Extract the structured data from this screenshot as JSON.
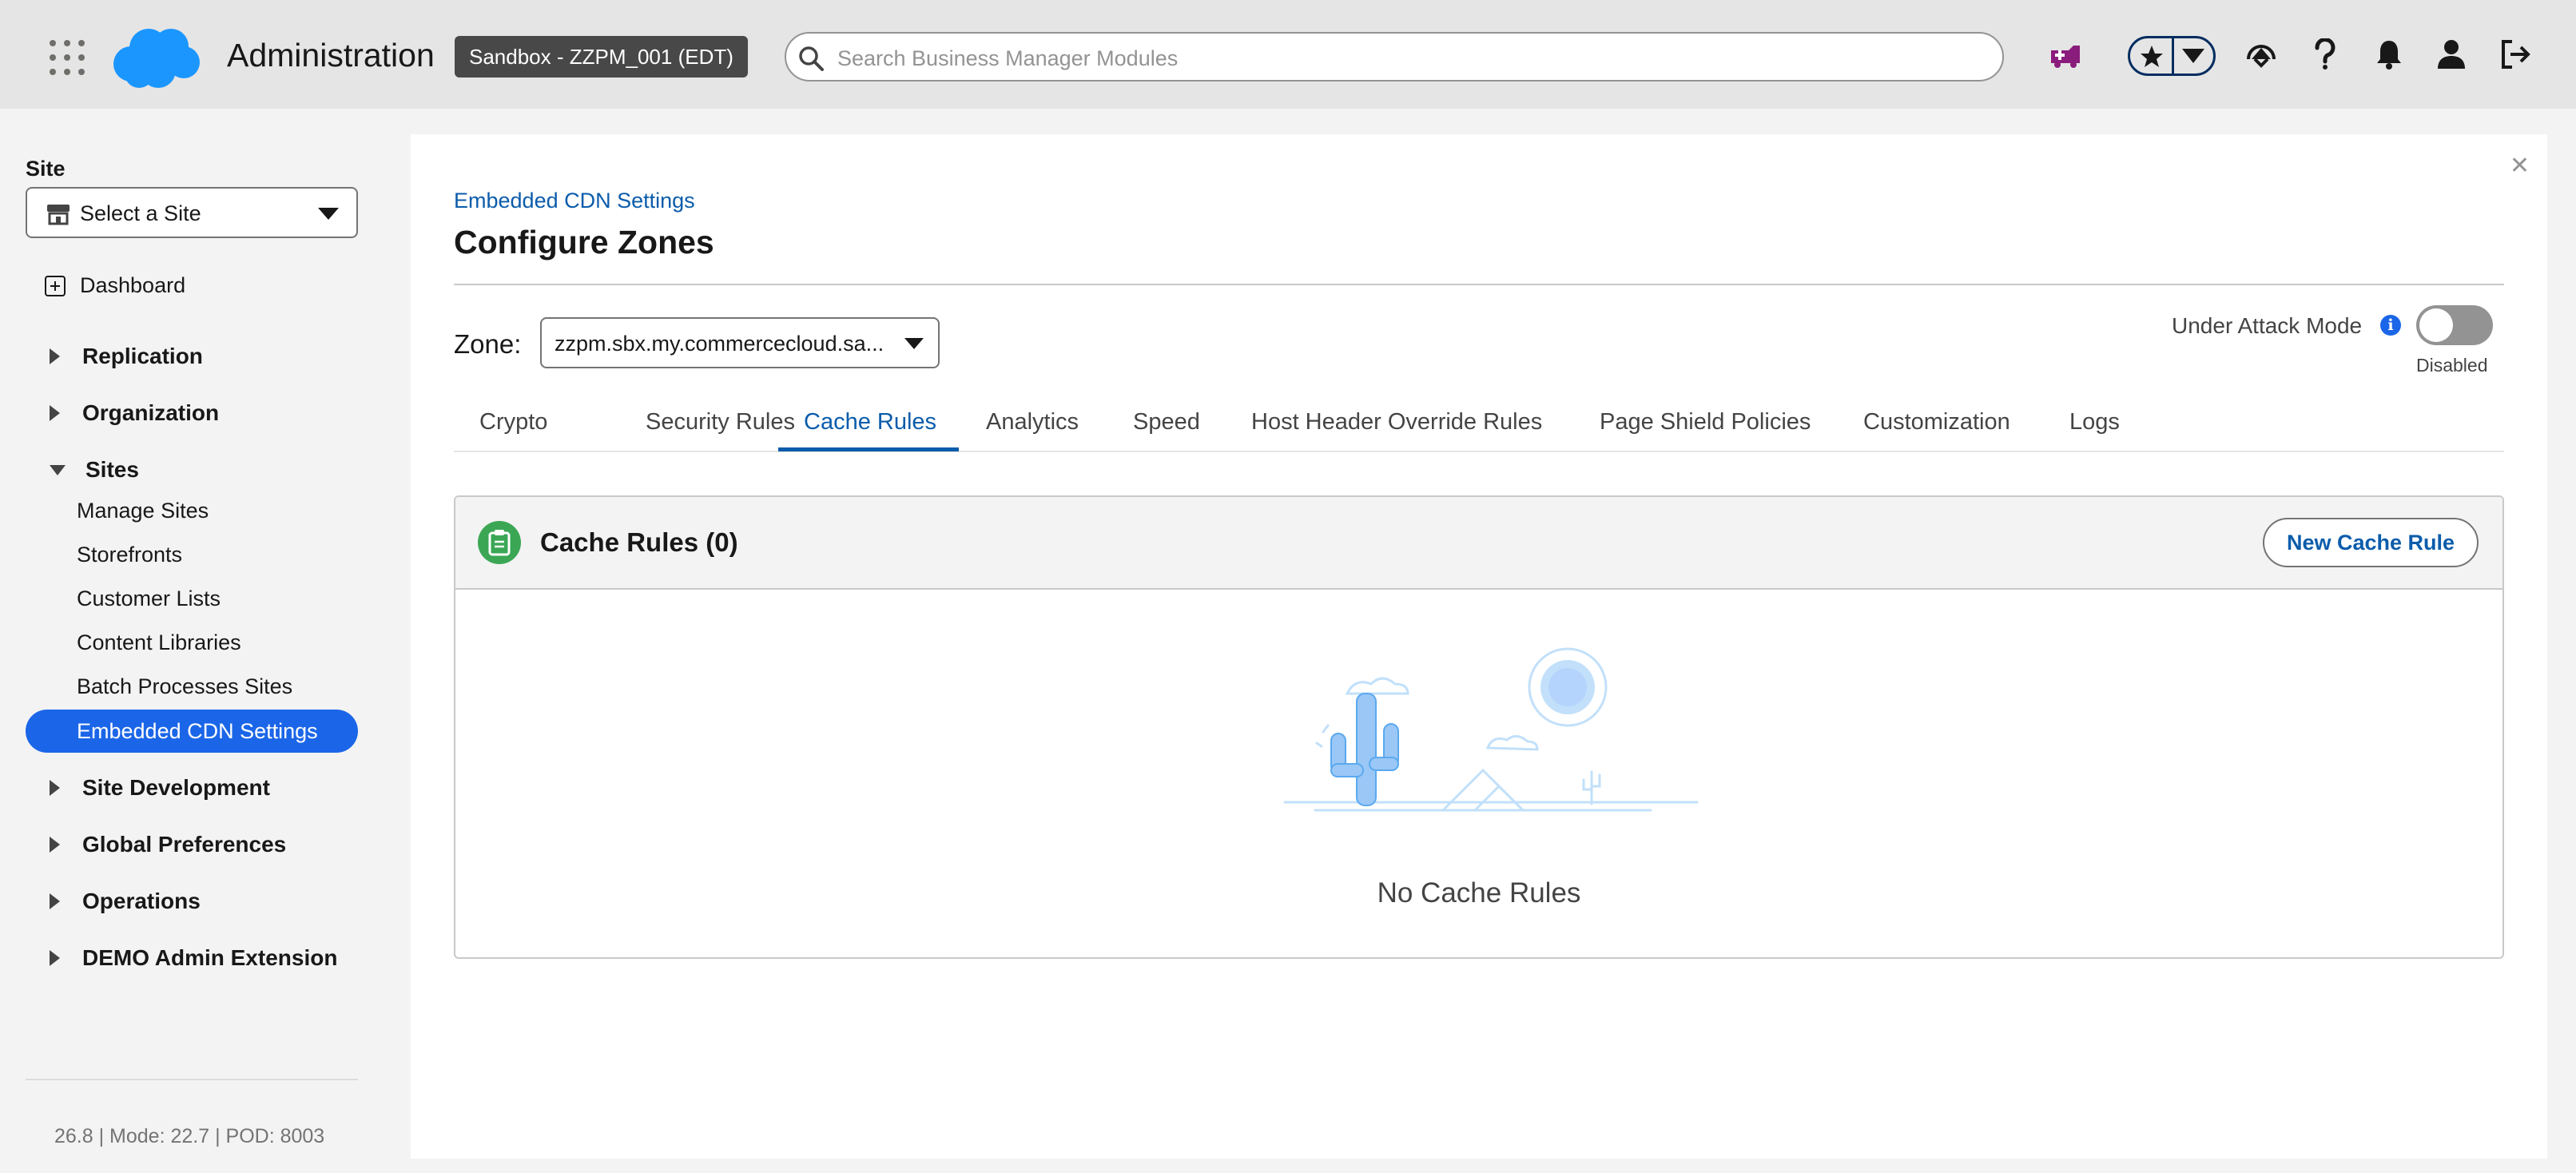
{
  "header": {
    "app_title": "Administration",
    "sandbox_badge": "Sandbox - ZZPM_001 (EDT)",
    "search_placeholder": "Search Business Manager Modules",
    "icons": [
      "app-launcher-icon",
      "salesforce-cloud-logo",
      "search-icon",
      "medic-icon",
      "favorites-star-icon",
      "favorites-dropdown-icon",
      "trailhead-icon",
      "help-icon",
      "notifications-bell-icon",
      "user-icon",
      "logout-icon"
    ]
  },
  "sidebar": {
    "site_label": "Site",
    "site_select_value": "Select a Site",
    "dashboard": "Dashboard",
    "sections": {
      "replication": "Replication",
      "organization": "Organization",
      "sites": "Sites",
      "site_development": "Site Development",
      "global_preferences": "Global Preferences",
      "operations": "Operations",
      "demo_admin_extension": "DEMO Admin Extension"
    },
    "sites_items": [
      "Manage Sites",
      "Storefronts",
      "Customer Lists",
      "Content Libraries",
      "Batch Processes Sites",
      "Embedded CDN Settings"
    ],
    "active_item": "Embedded CDN Settings",
    "version": "26.8 | Mode: 22.7 | POD: 8003"
  },
  "main": {
    "breadcrumb": "Embedded CDN Settings",
    "title": "Configure Zones",
    "zone_label": "Zone:",
    "zone_value": "zzpm.sbx.my.commercecloud.sa...",
    "under_attack_label": "Under Attack Mode",
    "under_attack_status": "Disabled",
    "under_attack_enabled": false,
    "tabs": [
      "Crypto",
      "Security Rules",
      "Cache Rules",
      "Analytics",
      "Speed",
      "Host Header Override Rules",
      "Page Shield Policies",
      "Customization",
      "Logs"
    ],
    "active_tab": "Cache Rules",
    "card": {
      "title": "Cache Rules (0)",
      "new_button": "New Cache Rule",
      "empty_text": "No Cache Rules"
    }
  },
  "colors": {
    "accent_blue": "#1b66e8",
    "link_blue": "#0b5cab",
    "medic_purple": "#8a1c7c",
    "card_icon_green": "#3ba755"
  }
}
